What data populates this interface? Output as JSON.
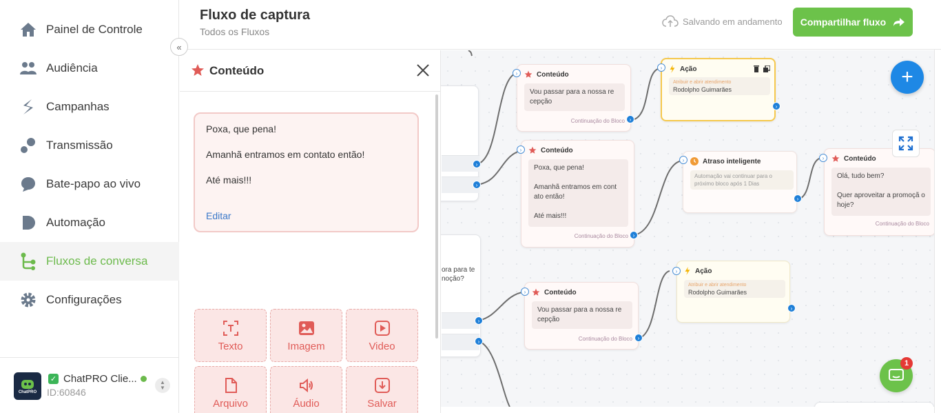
{
  "sidebar": {
    "items": [
      {
        "label": "Painel de Controle",
        "icon": "home-icon"
      },
      {
        "label": "Audiência",
        "icon": "users-icon"
      },
      {
        "label": "Campanhas",
        "icon": "campaign-icon"
      },
      {
        "label": "Transmissão",
        "icon": "broadcast-icon"
      },
      {
        "label": "Bate-papo ao vivo",
        "icon": "chat-bubble-icon"
      },
      {
        "label": "Automação",
        "icon": "automation-icon"
      },
      {
        "label": "Fluxos de conversa",
        "icon": "flow-icon"
      },
      {
        "label": "Configurações",
        "icon": "gear-icon"
      }
    ],
    "active_index": 6,
    "account": {
      "name": "ChatPRO Clie...",
      "id": "ID:60846",
      "avatar_text": "ChatPRO"
    }
  },
  "header": {
    "title": "Fluxo de captura",
    "subtitle": "Todos os Fluxos",
    "save_status": "Salvando em andamento",
    "share_label": "Compartilhar fluxo"
  },
  "panel": {
    "title": "Conteúdo",
    "message": {
      "lines": [
        "Poxa, que pena!",
        "Amanhã entramos em contato então!",
        "Até mais!!!"
      ],
      "edit_label": "Editar"
    },
    "tools": [
      {
        "label": "Texto",
        "icon": "text-icon"
      },
      {
        "label": "Imagem",
        "icon": "image-icon"
      },
      {
        "label": "Video",
        "icon": "video-icon"
      },
      {
        "label": "Arquivo",
        "icon": "file-icon"
      },
      {
        "label": "Áudio",
        "icon": "audio-icon"
      },
      {
        "label": "Salvar",
        "icon": "save-icon"
      }
    ]
  },
  "canvas": {
    "nodes": {
      "content1": {
        "title": "Conteúdo",
        "body": "Vou passar para a nossa re cepção",
        "footer": "Continuação do Bloco"
      },
      "action1": {
        "title": "Ação",
        "label": "Atribuir e abrir atendimento",
        "value": "Rodolpho Guimarães"
      },
      "content2": {
        "title": "Conteúdo",
        "body_lines": [
          "Poxa, que pena!",
          "Amanhã entramos em cont ato então!",
          "Até mais!!!"
        ],
        "footer": "Continuação do Bloco"
      },
      "delay1": {
        "title": "Atraso inteligente",
        "body": "Automação vai continuar para o próximo bloco após 1 Dias"
      },
      "content3": {
        "title": "Conteúdo",
        "body_lines": [
          "Olá, tudo bem?",
          "Quer aproveitar a promoçã o hoje?"
        ],
        "footer": "Continuação do Bloco"
      },
      "content4": {
        "title": "Conteúdo",
        "body": "Vou passar para a nossa re cepção",
        "footer": "Continuação do Bloco"
      },
      "action2": {
        "title": "Ação",
        "label": "Atribuir e abrir atendimento",
        "value": "Rodolpho Guimarães"
      },
      "side_partial": {
        "text": "ora para te noção?"
      }
    }
  },
  "chat_widget": {
    "badge": "1"
  },
  "colors": {
    "accent_green": "#6cc24a",
    "brand_blue": "#1e88e5",
    "content_red": "#e05b57"
  }
}
